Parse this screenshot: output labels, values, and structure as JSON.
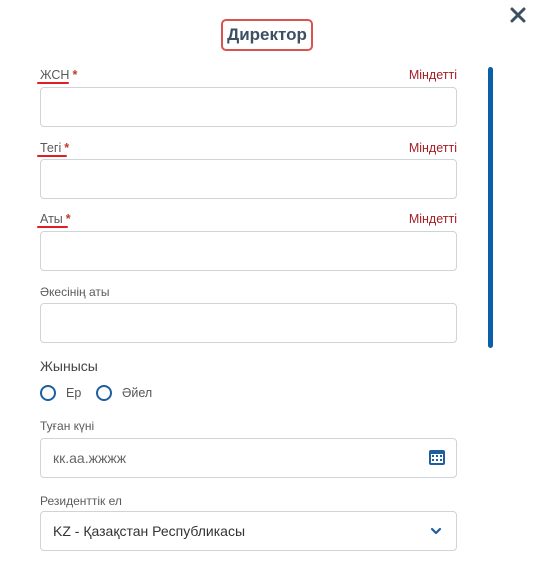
{
  "dialog": {
    "title": "Директор"
  },
  "fields": {
    "iin": {
      "label": "ЖСН",
      "required_mark": "*",
      "required_text": "Міндетті",
      "value": ""
    },
    "surname": {
      "label": "Тегі",
      "required_mark": "*",
      "required_text": "Міндетті",
      "value": ""
    },
    "name": {
      "label": "Аты",
      "required_mark": "*",
      "required_text": "Міндетті",
      "value": ""
    },
    "patronymic": {
      "label": "Әкесінің аты",
      "value": ""
    }
  },
  "gender": {
    "label": "Жынысы",
    "options": [
      "Ер",
      "Әйел"
    ]
  },
  "birth_date": {
    "label": "Туған күні",
    "placeholder": "кк.аа.жжжж"
  },
  "residence": {
    "label": "Резиденттік ел",
    "selected": "KZ - Қазақстан Республикасы"
  },
  "colors": {
    "accent": "#0b5ea8",
    "required": "#a61d24",
    "highlight": "#d9534f"
  }
}
